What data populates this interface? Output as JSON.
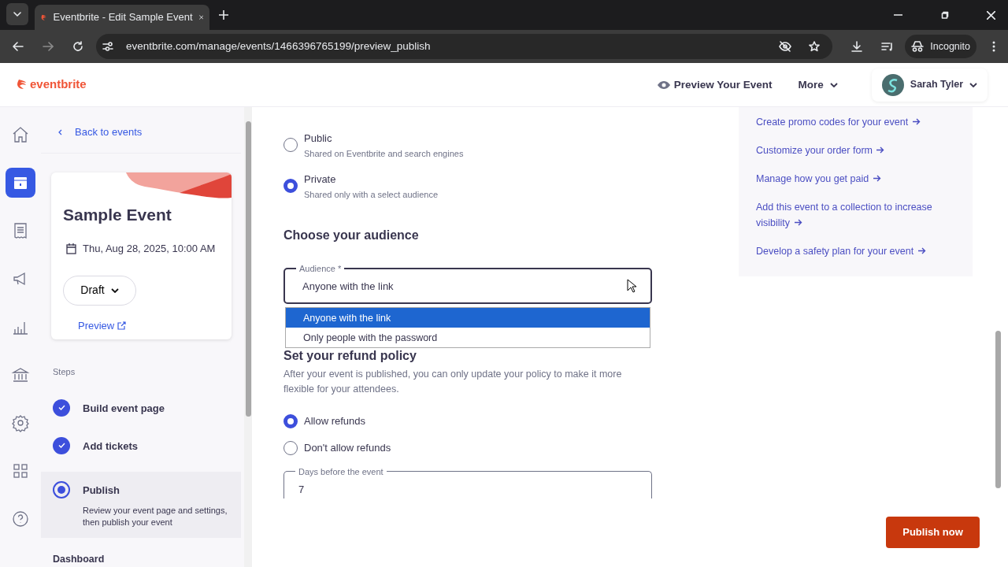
{
  "browser": {
    "tab_title": "Eventbrite - Edit Sample Event",
    "url": "eventbrite.com/manage/events/1466396765199/preview_publish",
    "profile": "Incognito"
  },
  "header": {
    "logo": "eventbrite",
    "preview": "Preview Your Event",
    "more": "More",
    "user": "Sarah Tyler"
  },
  "nav_rail": [
    {
      "selected": false
    },
    {
      "selected": true
    },
    {
      "selected": false
    },
    {
      "selected": false
    },
    {
      "selected": false
    },
    {
      "selected": false
    },
    {
      "selected": false
    },
    {
      "selected": false
    },
    {
      "selected": false
    }
  ],
  "sidebar": {
    "back": "Back to events",
    "event": {
      "title": "Sample Event",
      "date": "Thu, Aug 28, 2025, 10:00 AM",
      "status": "Draft",
      "preview": "Preview"
    },
    "steps_heading": "Steps",
    "steps": [
      {
        "label": "Build event page",
        "kind": "done"
      },
      {
        "label": "Add tickets",
        "kind": "done"
      },
      {
        "label": "Publish",
        "kind": "current",
        "description": "Review your event page and settings, then publish your event"
      }
    ],
    "next_heading": "Dashboard"
  },
  "visibility": {
    "options": [
      {
        "label": "Public",
        "description": "Shared on Eventbrite and search engines",
        "selected": false
      },
      {
        "label": "Private",
        "description": "Shared only with a select audience",
        "selected": true
      }
    ]
  },
  "audience": {
    "heading": "Choose your audience",
    "label": "Audience *",
    "value": "Anyone with the link",
    "open": true,
    "options": [
      {
        "label": "Anyone with the link",
        "selected": true
      },
      {
        "label": "Only people with the password",
        "selected": false
      }
    ]
  },
  "refund": {
    "heading": "Set your refund policy",
    "note": "After your event is published, you can only update your policy to make it more flexible for your attendees.",
    "options": [
      {
        "label": "Allow refunds",
        "selected": true
      },
      {
        "label": "Don't allow refunds",
        "selected": false
      }
    ],
    "days_label": "Days before the event",
    "days_value": "7"
  },
  "links": [
    "Create promo codes for your event",
    "Customize your order form",
    "Manage how you get paid",
    "Add this event to a collection to increase visibility",
    "Develop a safety plan for your event"
  ],
  "publish_button": "Publish now"
}
